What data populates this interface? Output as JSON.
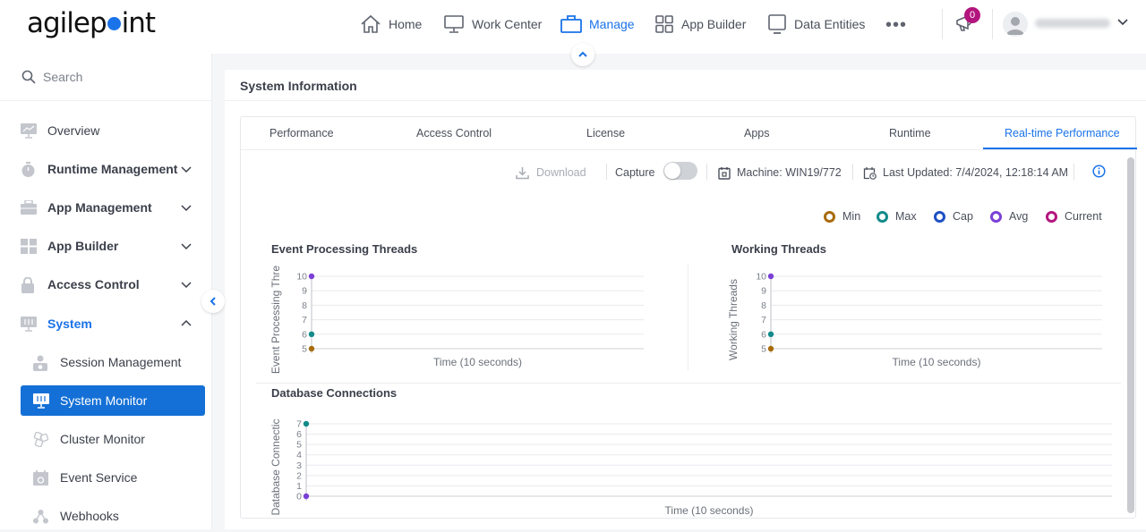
{
  "app": {
    "logo_text_a": "agilep",
    "logo_text_b": "int"
  },
  "topnav": {
    "items": [
      {
        "label": "Home",
        "icon": "home-icon"
      },
      {
        "label": "Work Center",
        "icon": "monitor-icon"
      },
      {
        "label": "Manage",
        "icon": "briefcase-icon",
        "active": true
      },
      {
        "label": "App Builder",
        "icon": "grid-icon"
      },
      {
        "label": "Data Entities",
        "icon": "screen-icon"
      }
    ],
    "more_label": "•••",
    "notification_count": "0",
    "user_name": "Administrator"
  },
  "sidebar": {
    "search_placeholder": "Search",
    "items": [
      {
        "label": "Overview",
        "icon": "chart-monitor-icon"
      },
      {
        "label": "Runtime Management",
        "icon": "stopwatch-icon",
        "expandable": true
      },
      {
        "label": "App Management",
        "icon": "toolbox-icon",
        "expandable": true
      },
      {
        "label": "App Builder",
        "icon": "tiles-icon",
        "expandable": true
      },
      {
        "label": "Access Control",
        "icon": "lock-icon",
        "expandable": true
      },
      {
        "label": "System",
        "icon": "system-icon",
        "expanded": true
      },
      {
        "label": "Session Management",
        "icon": "user-session-icon"
      },
      {
        "label": "System Monitor",
        "icon": "system-monitor-icon",
        "selected": true
      },
      {
        "label": "Cluster Monitor",
        "icon": "cluster-icon"
      },
      {
        "label": "Event Service",
        "icon": "calendar-icon"
      },
      {
        "label": "Webhooks",
        "icon": "webhook-icon"
      }
    ]
  },
  "main": {
    "title": "System Information",
    "tabs": [
      "Performance",
      "Access Control",
      "License",
      "Apps",
      "Runtime",
      "Real-time Performance"
    ],
    "active_tab": "Real-time Performance",
    "toolbar": {
      "download_label": "Download",
      "capture_label": "Capture",
      "capture_enabled": false,
      "machine_label": "Machine: WIN19/772",
      "last_updated_label": "Last Updated: 7/4/2024, 12:18:14 AM"
    },
    "legend": [
      {
        "label": "Min",
        "color": "#a86b0c"
      },
      {
        "label": "Max",
        "color": "#138a8a"
      },
      {
        "label": "Cap",
        "color": "#1d4fc4"
      },
      {
        "label": "Avg",
        "color": "#7a3fd6"
      },
      {
        "label": "Current",
        "color": "#b3157e"
      }
    ]
  },
  "chart_data": [
    {
      "type": "scatter",
      "title": "Event Processing Threads",
      "ylabel": "Event Processing Thre",
      "xlabel": "Time (10 seconds)",
      "ylim": [
        5,
        10
      ],
      "yticks": [
        "10",
        "9",
        "8",
        "7",
        "6",
        "5"
      ],
      "grid": true,
      "series": [
        {
          "name": "Avg",
          "color": "#7a3fd6",
          "values": [
            10
          ]
        },
        {
          "name": "Max",
          "color": "#138a8a",
          "values": [
            6
          ]
        },
        {
          "name": "Min",
          "color": "#a86b0c",
          "values": [
            5
          ]
        }
      ]
    },
    {
      "type": "scatter",
      "title": "Working Threads",
      "ylabel": "Working Threads",
      "xlabel": "Time (10 seconds)",
      "ylim": [
        5,
        10
      ],
      "yticks": [
        "10",
        "9",
        "8",
        "7",
        "6",
        "5"
      ],
      "grid": true,
      "series": [
        {
          "name": "Avg",
          "color": "#7a3fd6",
          "values": [
            10
          ]
        },
        {
          "name": "Max",
          "color": "#138a8a",
          "values": [
            6
          ]
        },
        {
          "name": "Min",
          "color": "#a86b0c",
          "values": [
            5
          ]
        }
      ]
    },
    {
      "type": "scatter",
      "title": "Database Connections",
      "ylabel": "Database Connectic",
      "xlabel": "Time (10 seconds)",
      "ylim": [
        0,
        7
      ],
      "yticks": [
        "7",
        "6",
        "5",
        "4",
        "3",
        "2",
        "1",
        "0"
      ],
      "grid": true,
      "series": [
        {
          "name": "Max",
          "color": "#138a8a",
          "values": [
            7
          ]
        },
        {
          "name": "Avg",
          "color": "#7a3fd6",
          "values": [
            0
          ]
        }
      ]
    }
  ]
}
